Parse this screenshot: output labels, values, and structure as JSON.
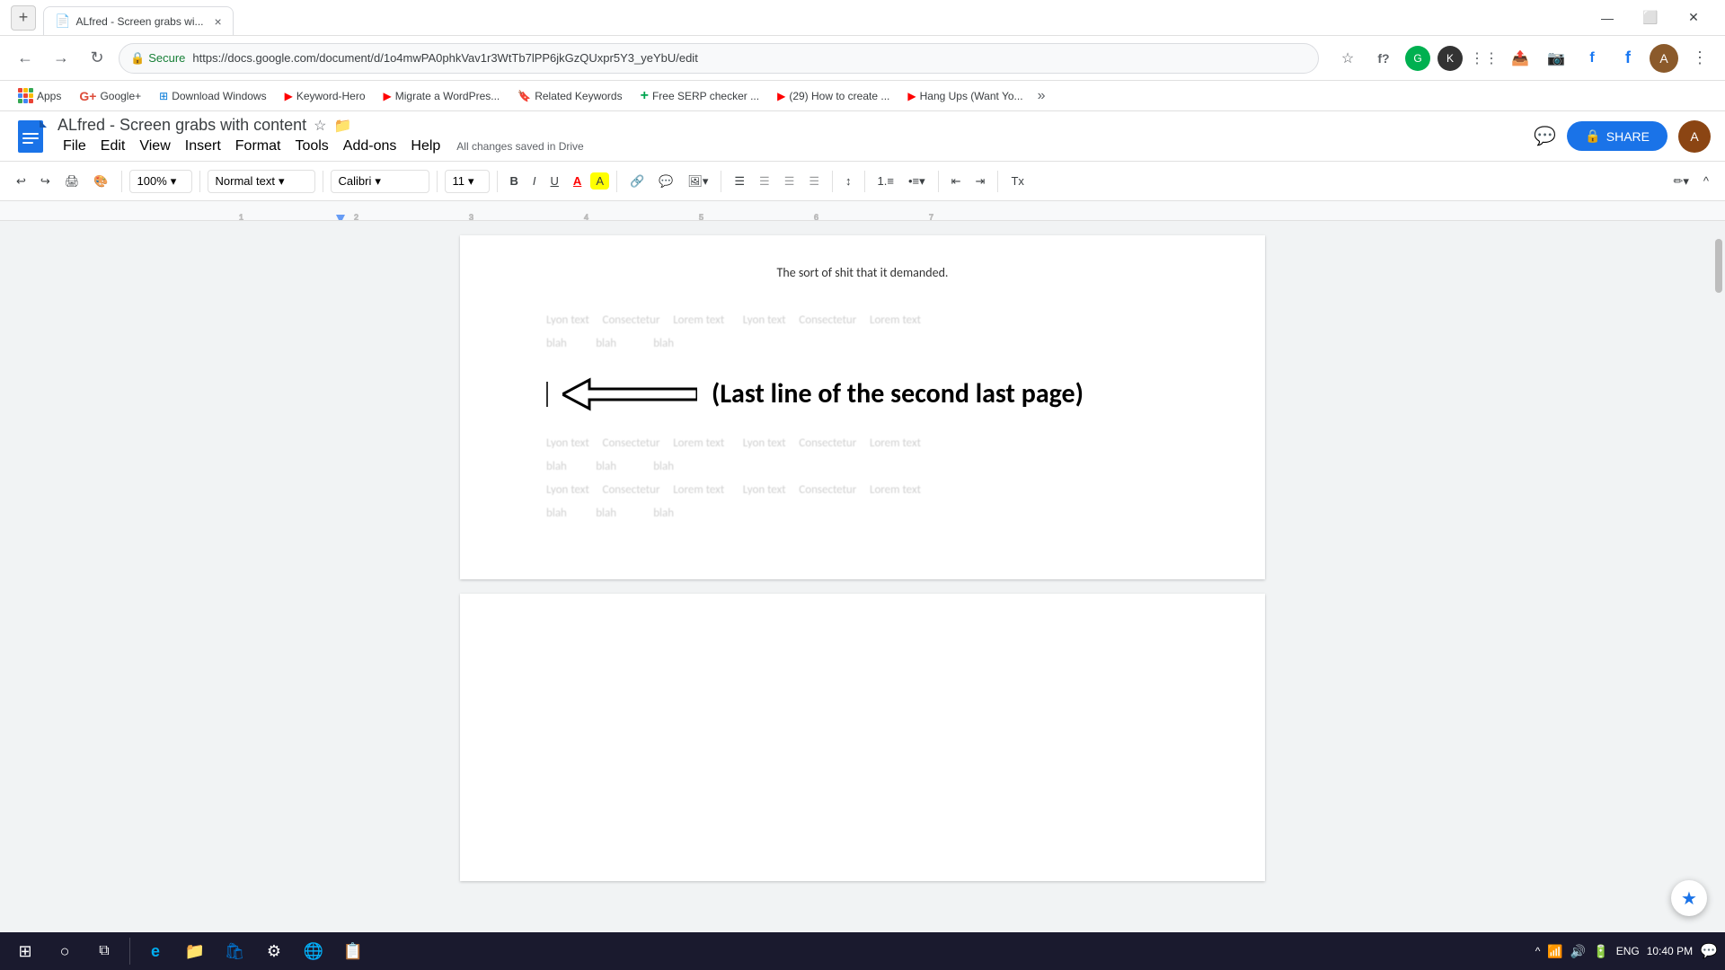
{
  "browser": {
    "tab": {
      "icon": "📄",
      "title": "ALfred - Screen grabs wi...",
      "close": "×"
    },
    "new_tab": "+",
    "window_controls": {
      "minimize": "—",
      "maximize": "⬜",
      "close": "✕"
    },
    "addressbar": {
      "back": "←",
      "forward": "→",
      "refresh": "↻",
      "secure_label": "Secure",
      "url": "https://docs.google.com/document/d/1o4mwPA0phkVav1r3WtTb7lPP6jkGzQUxpr5Y3_yeYbU/edit",
      "bookmark_icon": "☆",
      "extensions_icon": "f?"
    },
    "bookmarks": [
      {
        "label": "Apps",
        "icon": "grid"
      },
      {
        "label": "Google+",
        "icon": "G"
      },
      {
        "label": "Download Windows",
        "icon": "win"
      },
      {
        "label": "Keyword-Hero",
        "icon": "play"
      },
      {
        "label": "Migrate a WordPres...",
        "icon": "play"
      },
      {
        "label": "Related Keywords",
        "icon": "bookmark"
      },
      {
        "label": "Free SERP checker ...",
        "icon": "plus"
      },
      {
        "label": "(29) How to create ...",
        "icon": "play"
      },
      {
        "label": "Hang Ups (Want Yo...",
        "icon": "play"
      }
    ],
    "more_bookmarks": "»"
  },
  "doc": {
    "icon_color": "#1a73e8",
    "title": "ALfred - Screen grabs with content",
    "star": "☆",
    "folder": "📁",
    "menu": [
      "File",
      "Edit",
      "View",
      "Insert",
      "Format",
      "Tools",
      "Add-ons",
      "Help"
    ],
    "save_status": "All changes saved in Drive",
    "share_label": "SHARE",
    "share_icon": "🔒"
  },
  "toolbar": {
    "undo": "↩",
    "redo": "↪",
    "print": "🖨",
    "paint_format": "🎨",
    "zoom": "100%",
    "zoom_arrow": "▾",
    "style": "Normal text",
    "style_arrow": "▾",
    "font": "Calibri",
    "font_arrow": "▾",
    "size": "11",
    "size_arrow": "▾",
    "bold": "B",
    "italic": "I",
    "underline": "U",
    "text_color": "A",
    "highlight": "A",
    "link": "🔗",
    "comment": "💬",
    "image": "🖼",
    "image_arrow": "▾",
    "align_left": "≡",
    "align_center": "≡",
    "align_right": "≡",
    "align_justify": "≡",
    "line_spacing": "↕",
    "numbered_list": "1.",
    "bullet_list": "•",
    "indent_left": "⇤",
    "indent_right": "⇥",
    "clear_format": "Tx",
    "edit_mode": "✏",
    "collapse": "^"
  },
  "page": {
    "top_text": "The sort of shit that it demanded.",
    "arrow_text": "(Last line of the second last page)",
    "blurred_lines": [
      "Lyon text    Consectetur    Lorem text",
      "Lyon text    Consectetur    Lorem text    Lyon text    Consectetur    Lorem text",
      "blah         blah           blah",
      "Lyon text    Consectetur    Lorem text    Lyon text    Consectetur    Lorem text",
      "blah         blah           blah",
      "Lyon text    Consectetur    Lorem text    Lyon text    Consectetur    Lorem text"
    ]
  },
  "taskbar": {
    "start_icon": "⊞",
    "search_icon": "○",
    "task_view": "⧉",
    "edge_icon": "e",
    "explorer": "📁",
    "store": "🛍",
    "settings": "⚙",
    "browser_icon": "🌐",
    "other_icon": "📋",
    "time": "10:40 PM",
    "date": "",
    "lang": "ENG",
    "notification": "🔔",
    "systray": {
      "network": "wifi",
      "volume": "🔊",
      "battery": "🔋"
    }
  },
  "floating_button": {
    "icon": "★",
    "label": "Explore"
  }
}
